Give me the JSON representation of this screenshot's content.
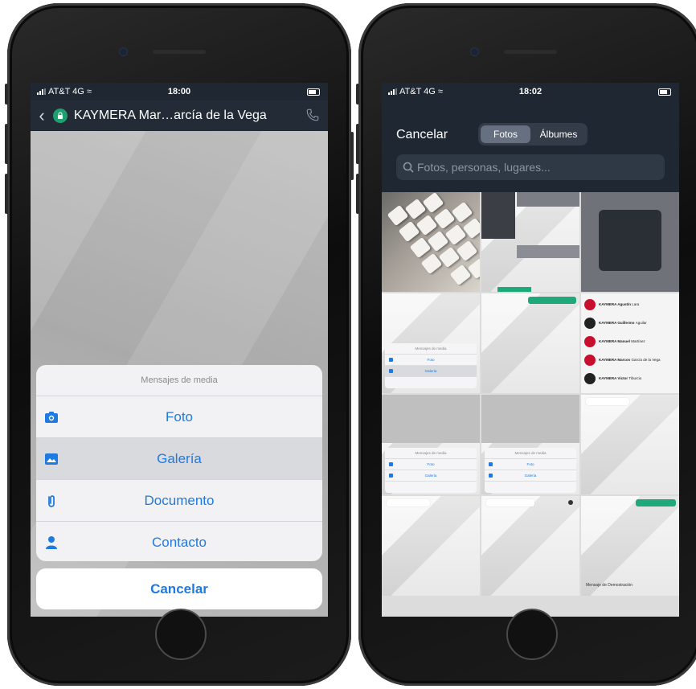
{
  "left_phone": {
    "status": {
      "carrier": "AT&T 4G",
      "time": "18:00"
    },
    "header": {
      "back_icon": "chevron-left-icon",
      "contact_name": "KAYMERA Mar…arcía de la Vega"
    },
    "action_sheet": {
      "title": "Mensajes de media",
      "items": [
        {
          "label": "Foto",
          "icon": "camera-icon"
        },
        {
          "label": "Galería",
          "icon": "image-icon"
        },
        {
          "label": "Documento",
          "icon": "paperclip-icon"
        },
        {
          "label": "Contacto",
          "icon": "person-icon"
        }
      ],
      "selected": "Galería",
      "cancel": "Cancelar"
    },
    "accent_color": "#1e7ae0"
  },
  "right_phone": {
    "status": {
      "carrier": "AT&T 4G",
      "time": "18:02"
    },
    "picker": {
      "cancel": "Cancelar",
      "tabs": [
        "Fotos",
        "Álbumes"
      ],
      "active_tab": "Fotos",
      "search_placeholder": "Fotos, personas, lugares..."
    },
    "thumbnails": {
      "contacts": [
        {
          "name": "KAYMERA Agustín",
          "detail": "Lara"
        },
        {
          "name": "KAYMERA Guillermo",
          "detail": "Aguilar"
        },
        {
          "name": "KAYMERA Manuel",
          "detail": "Martínez"
        },
        {
          "name": "KAYMERA Marcos",
          "detail": "García de la Vega"
        },
        {
          "name": "KAYMERA Victor",
          "detail": "Tiburcio"
        }
      ],
      "mini_sheet": [
        "Mensajes de media",
        "Foto",
        "Galería"
      ],
      "demo_message": "Mensaje de Demostración"
    }
  }
}
